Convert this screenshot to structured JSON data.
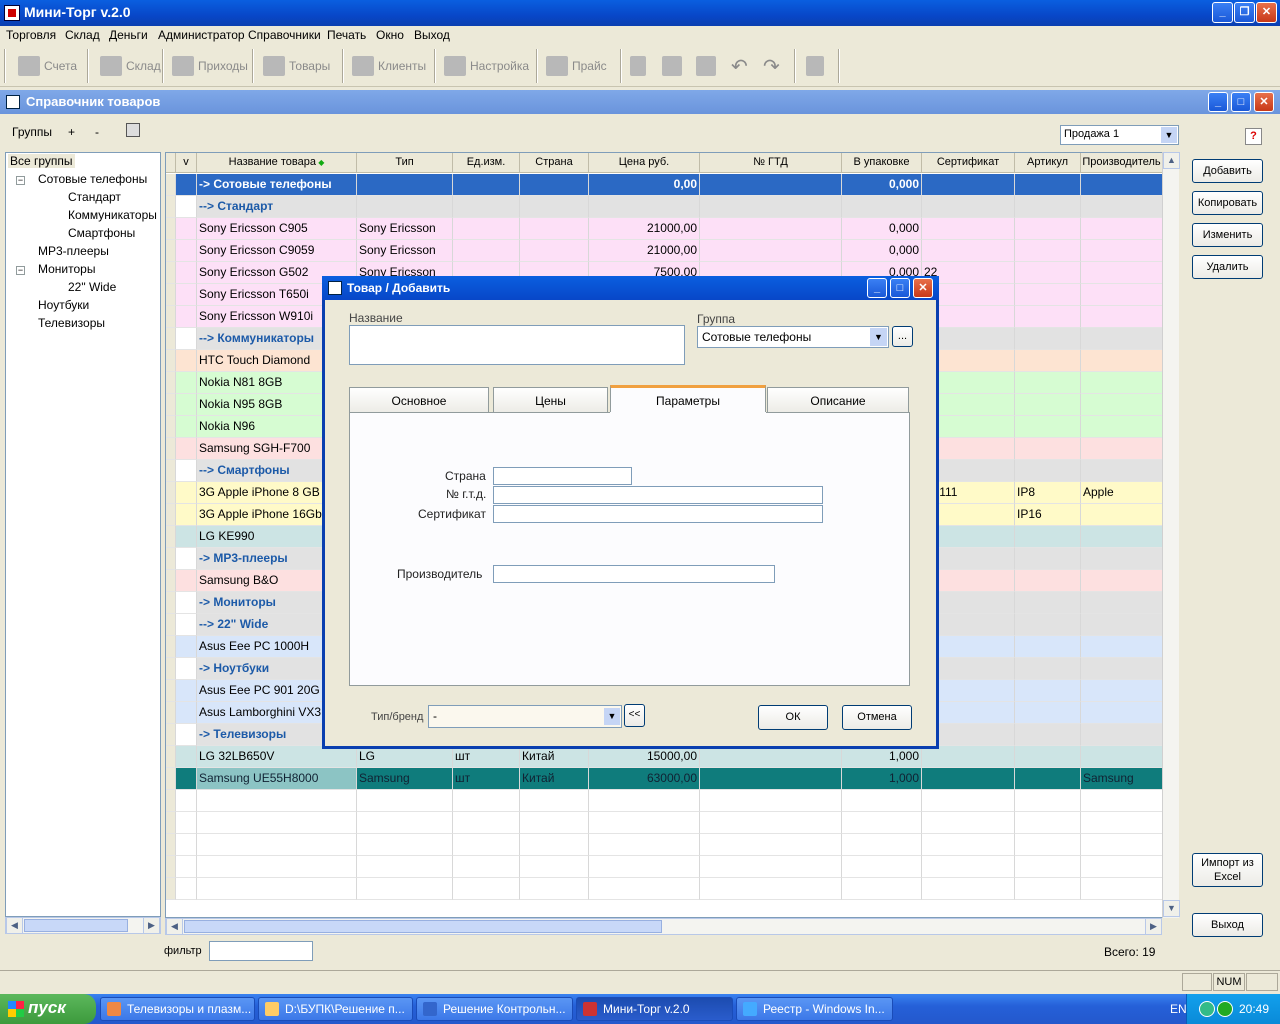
{
  "app": {
    "title": "Мини-Торг v.2.0"
  },
  "menu": [
    "Торговля",
    "Склад",
    "Деньги",
    "Администратор",
    "Справочники",
    "Печать",
    "Окно",
    "Выход"
  ],
  "toolbar": {
    "buttons": [
      "Счета",
      "Склад",
      "Приходы",
      "Товары",
      "Клиенты",
      "Настройка",
      "Прайс"
    ]
  },
  "child": {
    "title": "Справочник товаров",
    "groups_label": "Группы",
    "plus": "+",
    "minus": "-",
    "price_select": "Продажа 1",
    "help": "?"
  },
  "tree": [
    {
      "label": "Все группы",
      "level": 0
    },
    {
      "label": "Сотовые телефоны",
      "level": 1,
      "toggle": "−"
    },
    {
      "label": "Стандарт",
      "level": 2
    },
    {
      "label": "Коммуникаторы",
      "level": 2
    },
    {
      "label": "Смартфоны",
      "level": 2
    },
    {
      "label": "MP3-плееры",
      "level": 1
    },
    {
      "label": "Мониторы",
      "level": 1,
      "toggle": "−"
    },
    {
      "label": "22\" Wide",
      "level": 2
    },
    {
      "label": "Ноутбуки",
      "level": 1
    },
    {
      "label": "Телевизоры",
      "level": 1
    }
  ],
  "grid": {
    "headers": [
      "v",
      "Название товара",
      "Тип",
      "Ед.изм.",
      "Страна",
      "Цена руб.",
      "№ ГТД",
      "В упаковке",
      "Сертификат",
      "Артикул",
      "Производитель"
    ],
    "rows": [
      {
        "name": "-> Сотовые телефоны",
        "type": "",
        "unit": "",
        "country": "",
        "price": "0,00",
        "gtd": "",
        "pack": "0,000",
        "cert": "",
        "art": "",
        "maker": "",
        "kind": "group-sel"
      },
      {
        "name": "--> Стандарт",
        "type": "",
        "unit": "",
        "country": "",
        "price": "",
        "gtd": "",
        "pack": "",
        "cert": "",
        "art": "",
        "maker": "",
        "kind": "group"
      },
      {
        "name": "Sony Ericsson C905",
        "type": "Sony Ericsson",
        "unit": "",
        "country": "",
        "price": "21000,00",
        "gtd": "",
        "pack": "0,000",
        "cert": "",
        "art": "",
        "maker": "",
        "kind": "pink"
      },
      {
        "name": "Sony Ericsson C9059",
        "type": "Sony Ericsson",
        "unit": "",
        "country": "",
        "price": "21000,00",
        "gtd": "",
        "pack": "0,000",
        "cert": "",
        "art": "",
        "maker": "",
        "kind": "pink"
      },
      {
        "name": "Sony Ericsson G502",
        "type": "Sony Ericsson",
        "unit": "",
        "country": "",
        "price": "7500,00",
        "gtd": "",
        "pack": "0,000",
        "cert": "22",
        "art": "",
        "maker": "",
        "kind": "pink"
      },
      {
        "name": "Sony Ericsson T650i",
        "type": "",
        "unit": "",
        "country": "",
        "price": "",
        "gtd": "",
        "pack": "",
        "cert": "",
        "art": "",
        "maker": "",
        "kind": "pink"
      },
      {
        "name": "Sony Ericsson W910i",
        "type": "",
        "unit": "",
        "country": "",
        "price": "",
        "gtd": "",
        "pack": "",
        "cert": "",
        "art": "",
        "maker": "",
        "kind": "pink"
      },
      {
        "name": "--> Коммуникаторы",
        "type": "",
        "unit": "",
        "country": "",
        "price": "",
        "gtd": "",
        "pack": "",
        "cert": "",
        "art": "",
        "maker": "",
        "kind": "group"
      },
      {
        "name": "HTC Touch Diamond",
        "type": "",
        "unit": "",
        "country": "",
        "price": "",
        "gtd": "",
        "pack": "",
        "cert": "",
        "art": "",
        "maker": "",
        "kind": "peach"
      },
      {
        "name": "Nokia N81 8GB",
        "type": "",
        "unit": "",
        "country": "",
        "price": "",
        "gtd": "",
        "pack": "",
        "cert": "",
        "art": "",
        "maker": "",
        "kind": "green"
      },
      {
        "name": "Nokia N95 8GB",
        "type": "",
        "unit": "",
        "country": "",
        "price": "",
        "gtd": "",
        "pack": "",
        "cert": "",
        "art": "",
        "maker": "",
        "kind": "green"
      },
      {
        "name": "Nokia N96",
        "type": "",
        "unit": "",
        "country": "",
        "price": "",
        "gtd": "",
        "pack": "",
        "cert": "",
        "art": "",
        "maker": "",
        "kind": "green"
      },
      {
        "name": "Samsung SGH-F700",
        "type": "",
        "unit": "",
        "country": "",
        "price": "",
        "gtd": "",
        "pack": "",
        "cert": "",
        "art": "",
        "maker": "",
        "kind": "rose"
      },
      {
        "name": "--> Смартфоны",
        "type": "",
        "unit": "",
        "country": "",
        "price": "",
        "gtd": "",
        "pack": "",
        "cert": "",
        "art": "",
        "maker": "",
        "kind": "group"
      },
      {
        "name": "3G Apple iPhone  8 GB",
        "type": "",
        "unit": "",
        "country": "",
        "price": "",
        "gtd": "",
        "pack": "",
        "cert": "от 111",
        "art": "IP8",
        "maker": "Apple",
        "kind": "yellow"
      },
      {
        "name": "3G Apple iPhone 16Gb",
        "type": "",
        "unit": "",
        "country": "",
        "price": "",
        "gtd": "",
        "pack": "",
        "cert": "",
        "art": "IP16",
        "maker": "",
        "kind": "yellow"
      },
      {
        "name": "LG KE990",
        "type": "",
        "unit": "",
        "country": "",
        "price": "",
        "gtd": "",
        "pack": "",
        "cert": "",
        "art": "",
        "maker": "",
        "kind": "teal"
      },
      {
        "name": "-> MP3-плееры",
        "type": "",
        "unit": "",
        "country": "",
        "price": "",
        "gtd": "",
        "pack": "",
        "cert": "",
        "art": "",
        "maker": "",
        "kind": "group"
      },
      {
        "name": "Samsung B&O",
        "type": "",
        "unit": "",
        "country": "",
        "price": "",
        "gtd": "",
        "pack": "",
        "cert": "",
        "art": "",
        "maker": "",
        "kind": "rose"
      },
      {
        "name": "-> Мониторы",
        "type": "",
        "unit": "",
        "country": "",
        "price": "",
        "gtd": "",
        "pack": "",
        "cert": "",
        "art": "",
        "maker": "",
        "kind": "group"
      },
      {
        "name": "--> 22\" Wide",
        "type": "",
        "unit": "",
        "country": "",
        "price": "",
        "gtd": "",
        "pack": "",
        "cert": "",
        "art": "",
        "maker": "",
        "kind": "group"
      },
      {
        "name": "Asus Eee PC 1000H",
        "type": "",
        "unit": "",
        "country": "",
        "price": "",
        "gtd": "",
        "pack": "",
        "cert": "",
        "art": "",
        "maker": "",
        "kind": "blue"
      },
      {
        "name": "-> Ноутбуки",
        "type": "",
        "unit": "",
        "country": "",
        "price": "",
        "gtd": "",
        "pack": "",
        "cert": "",
        "art": "",
        "maker": "",
        "kind": "group"
      },
      {
        "name": "Asus Eee PC 901 20G",
        "type": "",
        "unit": "",
        "country": "",
        "price": "",
        "gtd": "",
        "pack": "",
        "cert": "",
        "art": "",
        "maker": "",
        "kind": "blue"
      },
      {
        "name": "Asus Lamborghini VX3",
        "type": "",
        "unit": "",
        "country": "",
        "price": "",
        "gtd": "",
        "pack": "",
        "cert": "",
        "art": "",
        "maker": "",
        "kind": "blue"
      },
      {
        "name": "-> Телевизоры",
        "type": "",
        "unit": "",
        "country": "",
        "price": "",
        "gtd": "",
        "pack": "",
        "cert": "",
        "art": "",
        "maker": "",
        "kind": "group"
      },
      {
        "name": "LG 32LB650V",
        "type": "LG",
        "unit": "шт",
        "country": "Китай",
        "price": "15000,00",
        "gtd": "",
        "pack": "1,000",
        "cert": "",
        "art": "",
        "maker": "",
        "kind": "teal"
      },
      {
        "name": "Samsung UE55H8000",
        "type": "Samsung",
        "unit": "шт",
        "country": "Китай",
        "price": "63000,00",
        "gtd": "",
        "pack": "1,000",
        "cert": "",
        "art": "",
        "maker": "Samsung",
        "kind": "selected"
      }
    ]
  },
  "side_buttons": {
    "add": "Добавить",
    "copy": "Копировать",
    "edit": "Изменить",
    "delete": "Удалить",
    "import": "Импорт из Excel",
    "exit": "Выход"
  },
  "filter": {
    "label": "фильтр",
    "value": ""
  },
  "total": "Всего: 19",
  "status": {
    "num": "NUM"
  },
  "dialog": {
    "title": "Товар / Добавить",
    "name_label": "Название",
    "name_value": "",
    "group_label": "Группа",
    "group_value": "Сотовые телефоны",
    "browse": "...",
    "tabs": [
      "Основное",
      "Цены",
      "Параметры",
      "Описание"
    ],
    "active_tab": "Параметры",
    "country_label": "Страна",
    "gtd_label": "№ г.т.д.",
    "cert_label": "Сертификат",
    "maker_label": "Производитель",
    "brand_label": "Тип/бренд",
    "brand_value": "-",
    "back": "<<",
    "ok": "ОК",
    "cancel": "Отмена"
  },
  "taskbar": {
    "start": "пуск",
    "tasks": [
      "Телевизоры и плазм...",
      "D:\\БУПК\\Решение п...",
      "Решение Контрольн...",
      "Мини-Торг v.2.0",
      "Реестр - Windows In..."
    ],
    "lang": "EN",
    "clock": "20:49"
  }
}
